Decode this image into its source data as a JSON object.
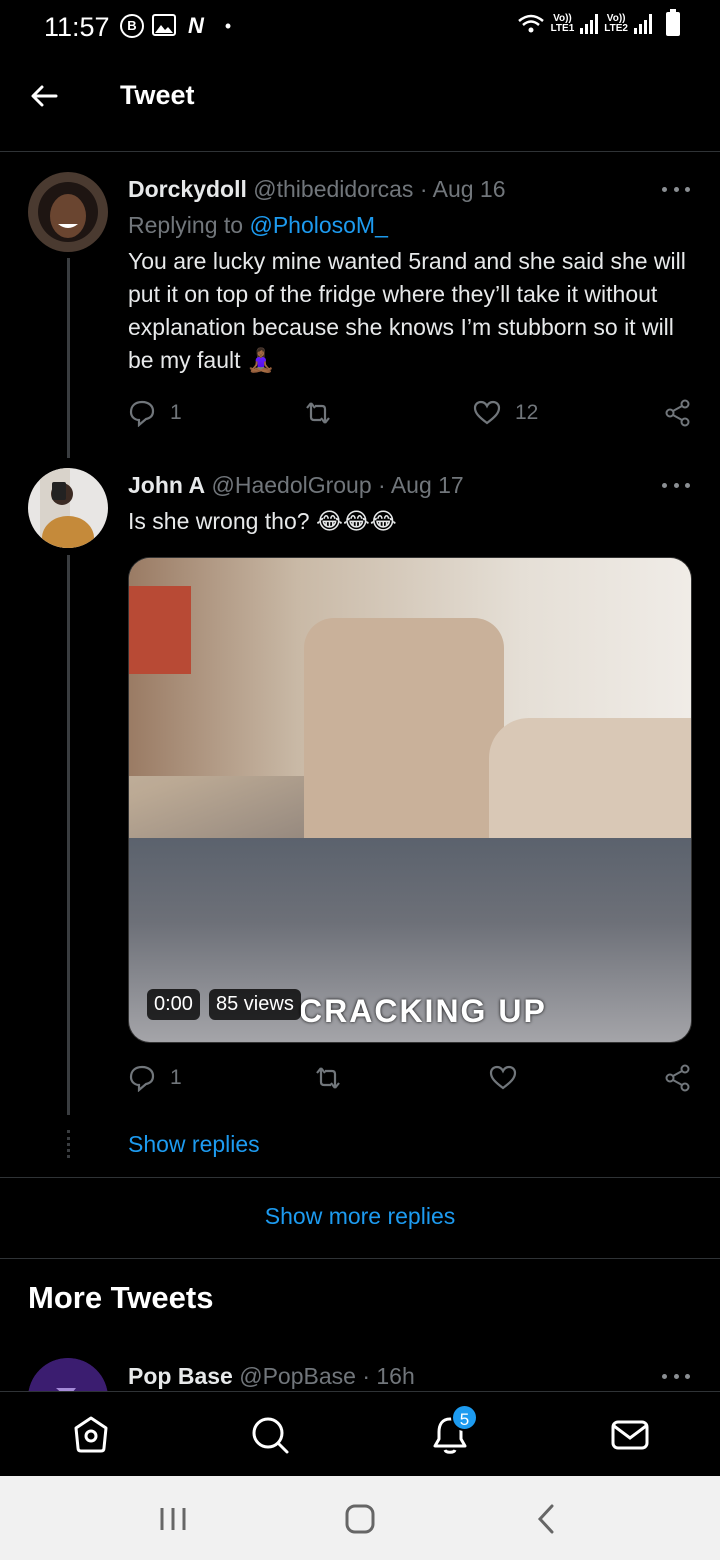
{
  "status_bar": {
    "time": "11:57",
    "left_icons": [
      "b-circle-icon",
      "image-icon",
      "n-icon",
      "dot-icon"
    ],
    "lte1": "Vo))\nLTE1",
    "lte2": "Vo))\nLTE2"
  },
  "header": {
    "title": "Tweet"
  },
  "tweets": [
    {
      "name": "Dorckydoll",
      "handle": "@thibedidorcas",
      "date": "· Aug 16",
      "replying_prefix": "Replying to ",
      "replying_to": "@PholosoM_",
      "body": "You are lucky mine wanted 5rand and she said she will put it on top of the fridge where they’ll take it without explanation because she knows I’m stubborn so it will be my fault 🧘🏾‍♀️",
      "replies": "1",
      "retweets": "",
      "likes": "12"
    },
    {
      "name": "John A",
      "handle": "@HaedolGroup",
      "date": "· Aug 17",
      "body": "Is she wrong tho? 😂😂😂",
      "media": {
        "caption": "CRACKING UP",
        "duration": "0:00",
        "views": "85 views"
      },
      "replies": "1",
      "retweets": "",
      "likes": ""
    }
  ],
  "show_replies": "Show replies",
  "show_more_replies": "Show more replies",
  "more_tweets": {
    "title": "More Tweets",
    "first": {
      "name": "Pop Base",
      "handle": "@PopBase",
      "date": "· 16h"
    }
  },
  "tabbar": {
    "items": [
      "home-icon",
      "search-icon",
      "notifications-icon",
      "messages-icon"
    ],
    "notification_count": "5"
  },
  "colors": {
    "accent": "#1d9bf0",
    "background": "#000000",
    "muted": "#71767b"
  }
}
